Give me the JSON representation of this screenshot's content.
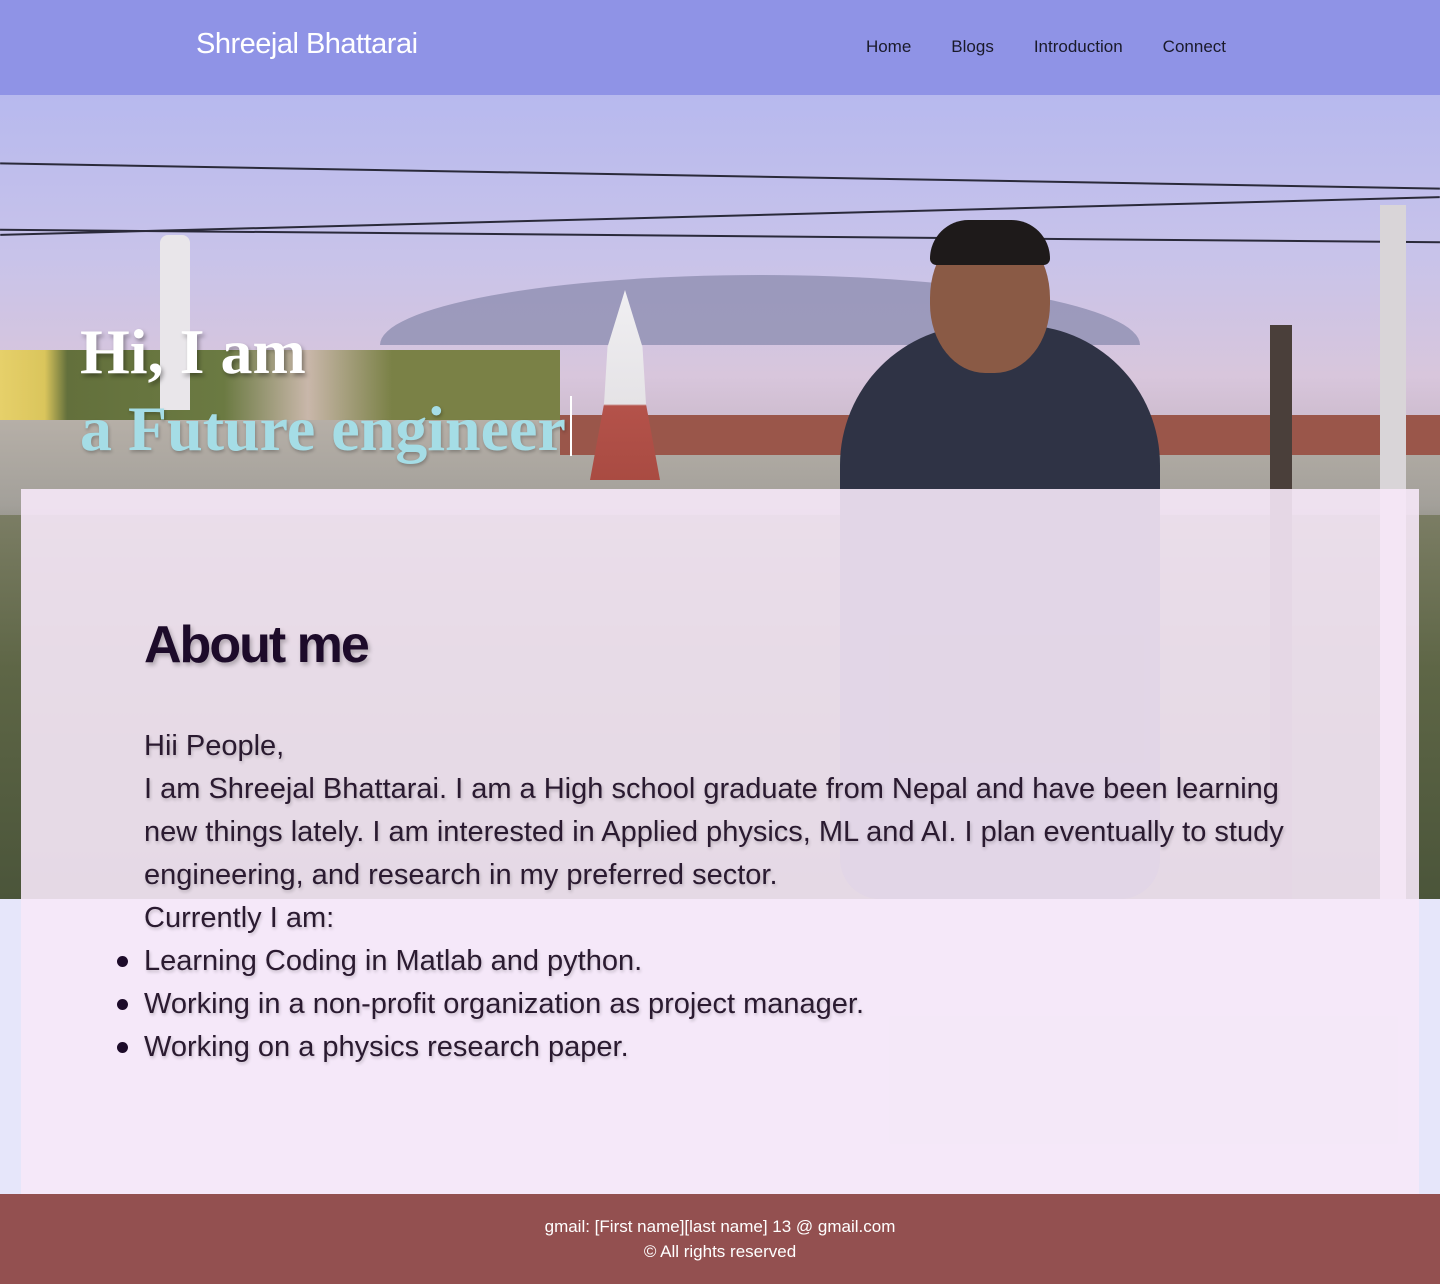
{
  "header": {
    "brand": "Shreejal Bhattarai",
    "nav": [
      "Home",
      "Blogs",
      "Introduction",
      "Connect"
    ]
  },
  "hero": {
    "greeting": "Hi, I am",
    "typed_text": "a Future engineer"
  },
  "about": {
    "heading": "About me",
    "greeting_line": "Hii People,",
    "paragraph": "I am Shreejal Bhattarai. I am a High school graduate from Nepal and have been learning new things lately. I am interested in Applied physics, ML and AI. I plan eventually to study engineering, and research in my preferred sector.",
    "currently_label": "Currently I am:",
    "items": [
      "Learning Coding in Matlab and python.",
      "Working in a non-profit organization as project manager.",
      "Working on a physics research paper."
    ]
  },
  "footer": {
    "contact": "gmail: [First name][last name] 13 @ gmail.com",
    "copyright": "© All rights reserved"
  },
  "colors": {
    "navbar": "#8f93e6",
    "hero_subtitle": "#a5dde6",
    "card": "#f6e8f8",
    "footer": "#935050",
    "page_bg": "#e6e6fa"
  }
}
